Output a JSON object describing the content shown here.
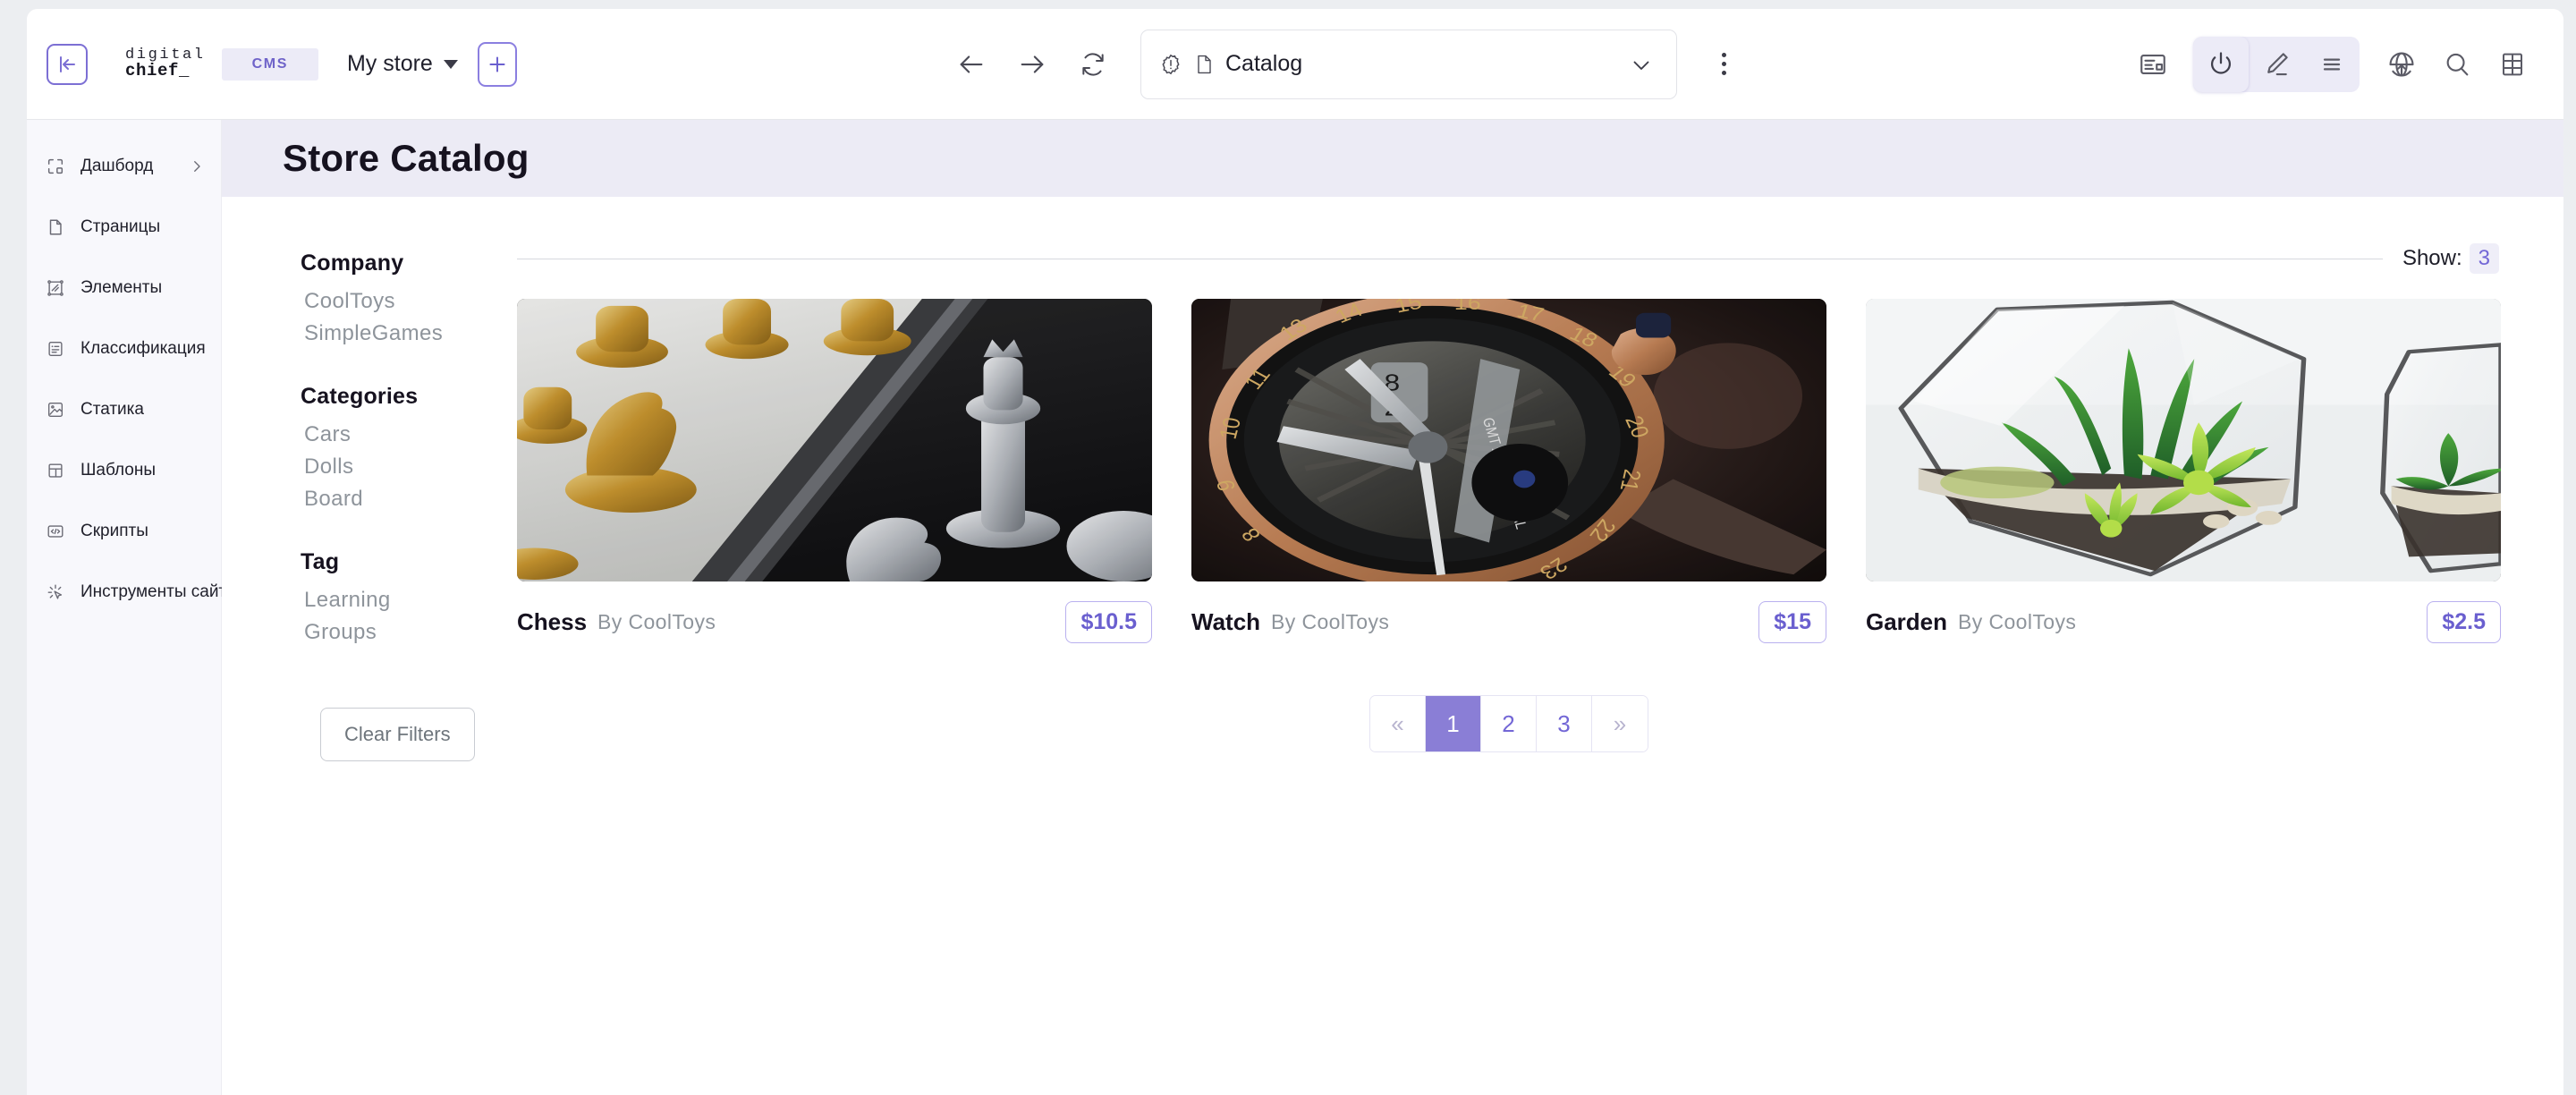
{
  "topbar": {
    "collapse_icon": "collapse-sidebar-icon",
    "brand_line1": "digital",
    "brand_line2": "chief_",
    "cms_chip": "CMS",
    "store_selector": "My store",
    "add_button": "+",
    "nav": {
      "back": "back-arrow-icon",
      "forward": "forward-arrow-icon",
      "reload": "reload-icon"
    },
    "address": {
      "warning_icon": "warning-badge-icon",
      "page_icon": "page-file-icon",
      "value": "Catalog",
      "chevron": "chevron-down-icon"
    },
    "kebab": "more-options-icon",
    "right_icons": [
      "layout-blocks-icon",
      "power-toggle-icon",
      "edit-pencil-icon",
      "menu-lines-icon",
      "publish-globe-icon",
      "search-icon",
      "grid-table-icon"
    ]
  },
  "sidebar": {
    "items": [
      {
        "label": "Дашборд",
        "icon": "dashboard-icon",
        "has_chevron": true
      },
      {
        "label": "Страницы",
        "icon": "pages-file-icon",
        "has_chevron": false
      },
      {
        "label": "Элементы",
        "icon": "elements-frame-icon",
        "has_chevron": false
      },
      {
        "label": "Классификация",
        "icon": "classification-card-icon",
        "has_chevron": false
      },
      {
        "label": "Статика",
        "icon": "static-image-icon",
        "has_chevron": false
      },
      {
        "label": "Шаблоны",
        "icon": "templates-layout-icon",
        "has_chevron": false
      },
      {
        "label": "Скрипты",
        "icon": "scripts-code-icon",
        "has_chevron": false
      },
      {
        "label": "Инструменты сайта",
        "icon": "site-tools-icon",
        "has_chevron": true
      }
    ]
  },
  "page": {
    "title": "Store Catalog"
  },
  "filters": {
    "groups": [
      {
        "heading": "Company",
        "options": [
          "CoolToys",
          "SimpleGames"
        ]
      },
      {
        "heading": "Categories",
        "options": [
          "Cars",
          "Dolls",
          "Board"
        ]
      },
      {
        "heading": "Tag",
        "options": [
          "Learning",
          "Groups"
        ]
      }
    ],
    "clear_label": "Clear Filters"
  },
  "catalog": {
    "show_label": "Show:",
    "show_count": "3",
    "products": [
      {
        "name": "Chess",
        "by": "By CoolToys",
        "price": "$10.5",
        "image": "chess-board-gold-silver-pieces"
      },
      {
        "name": "Watch",
        "by": "By CoolToys",
        "price": "$15",
        "image": "luxury-wristwatch-rose-gold"
      },
      {
        "name": "Garden",
        "by": "By CoolToys",
        "price": "$2.5",
        "image": "geometric-glass-terrarium-succulents"
      }
    ],
    "pagination": {
      "prev": "«",
      "next": "»",
      "pages": [
        "1",
        "2",
        "3"
      ],
      "current": "1"
    }
  },
  "colors": {
    "accent": "#7367d6",
    "accent_solid": "#8a7ed6",
    "title_band": "#ecebf5",
    "sidebar_bg": "#f8f8fc",
    "muted_text": "#8e949b"
  }
}
